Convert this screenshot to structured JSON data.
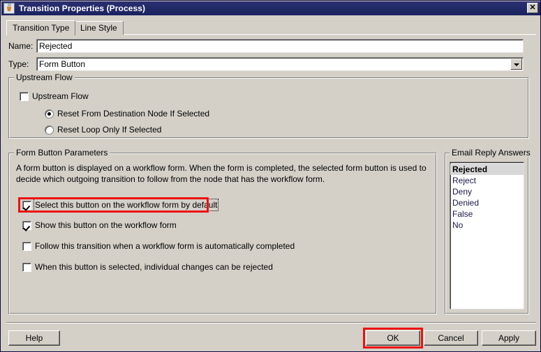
{
  "window": {
    "title": "Transition Properties (Process)",
    "icon": "java-application-icon",
    "close_label": "✕"
  },
  "tabs": [
    {
      "label": "Transition Type",
      "active": true
    },
    {
      "label": "Line Style",
      "active": false
    }
  ],
  "fields": {
    "name": {
      "label": "Name:",
      "value": "Rejected"
    },
    "type": {
      "label": "Type:",
      "value": "Form Button",
      "arrow_icon": "chevron-down-icon"
    }
  },
  "upstream_flow": {
    "group_title": "Upstream Flow",
    "checkbox": {
      "label": "Upstream Flow",
      "checked": false
    },
    "radios": [
      {
        "label": "Reset From Destination Node If Selected",
        "checked": true
      },
      {
        "label": "Reset Loop Only If Selected",
        "checked": false
      }
    ]
  },
  "form_button_parameters": {
    "group_title": "Form Button Parameters",
    "description": "A form button is displayed on a workflow form.  When the form is completed, the selected form button is used to decide which outgoing transition to follow from the node that has the workflow form.",
    "checkboxes": [
      {
        "label": "Select this button on the workflow form by default",
        "checked": true,
        "focused": true,
        "highlighted": true
      },
      {
        "label": "Show this button on the workflow form",
        "checked": true,
        "focused": false,
        "highlighted": false
      },
      {
        "label": "Follow this transition when a workflow form is automatically completed",
        "checked": false,
        "focused": false,
        "highlighted": false
      },
      {
        "label": "When this button is selected, individual changes can be rejected",
        "checked": false,
        "focused": false,
        "highlighted": false
      }
    ]
  },
  "email_reply_answers": {
    "group_title": "Email Reply Answers",
    "items": [
      {
        "label": "Rejected",
        "selected": true
      },
      {
        "label": "Reject",
        "selected": false
      },
      {
        "label": "Deny",
        "selected": false
      },
      {
        "label": "Denied",
        "selected": false
      },
      {
        "label": "False",
        "selected": false
      },
      {
        "label": "No",
        "selected": false
      }
    ]
  },
  "footer": {
    "help_label": "Help",
    "ok_label": "OK",
    "cancel_label": "Cancel",
    "apply_label": "Apply",
    "ok_highlighted": true
  },
  "colors": {
    "titlebar": "#232a68",
    "face": "#d4d0c8",
    "highlight_annotation": "#ee1111",
    "list_text": "#191945"
  }
}
